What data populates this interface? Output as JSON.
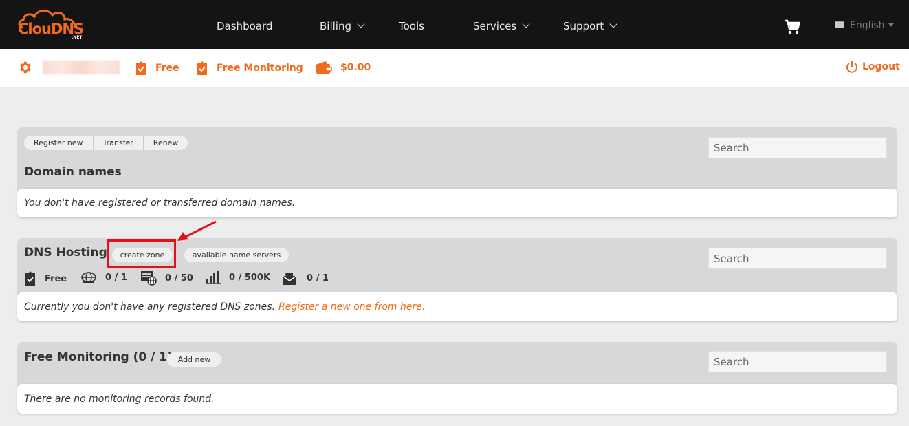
{
  "brand": {
    "name": "ClouDNS",
    "suffix": ".NET"
  },
  "nav": {
    "dashboard": "Dashboard",
    "billing": "Billing",
    "tools": "Tools",
    "services": "Services",
    "support": "Support",
    "language": "English"
  },
  "account": {
    "plan": "Free",
    "monitoring": "Free Monitoring",
    "balance": "$0.00",
    "logout": "Logout"
  },
  "domains": {
    "buttons": [
      "Register new",
      "Transfer",
      "Renew"
    ],
    "title": "Domain names",
    "search_placeholder": "Search",
    "empty_text": "You don't have registered or transferred domain names."
  },
  "dns": {
    "title": "DNS Hosting",
    "create_zone": "create zone",
    "name_servers": "available name servers",
    "search_placeholder": "Search",
    "stats": {
      "plan": "Free",
      "zones": "0 / 1",
      "records": "0 / 50",
      "queries": "0 / 500K",
      "mail_forwards": "0 / 1"
    },
    "empty_text": "Currently you don't have any registered DNS zones.",
    "empty_link": "Register a new one from here."
  },
  "monitoring": {
    "title": "Free Monitoring (0 / 1)",
    "add_new": "Add new",
    "search_placeholder": "Search",
    "empty_text": "There are no monitoring records found."
  },
  "colors": {
    "accent": "#f26b1d",
    "highlight": "#e3121a",
    "nav_bg": "#141414"
  }
}
